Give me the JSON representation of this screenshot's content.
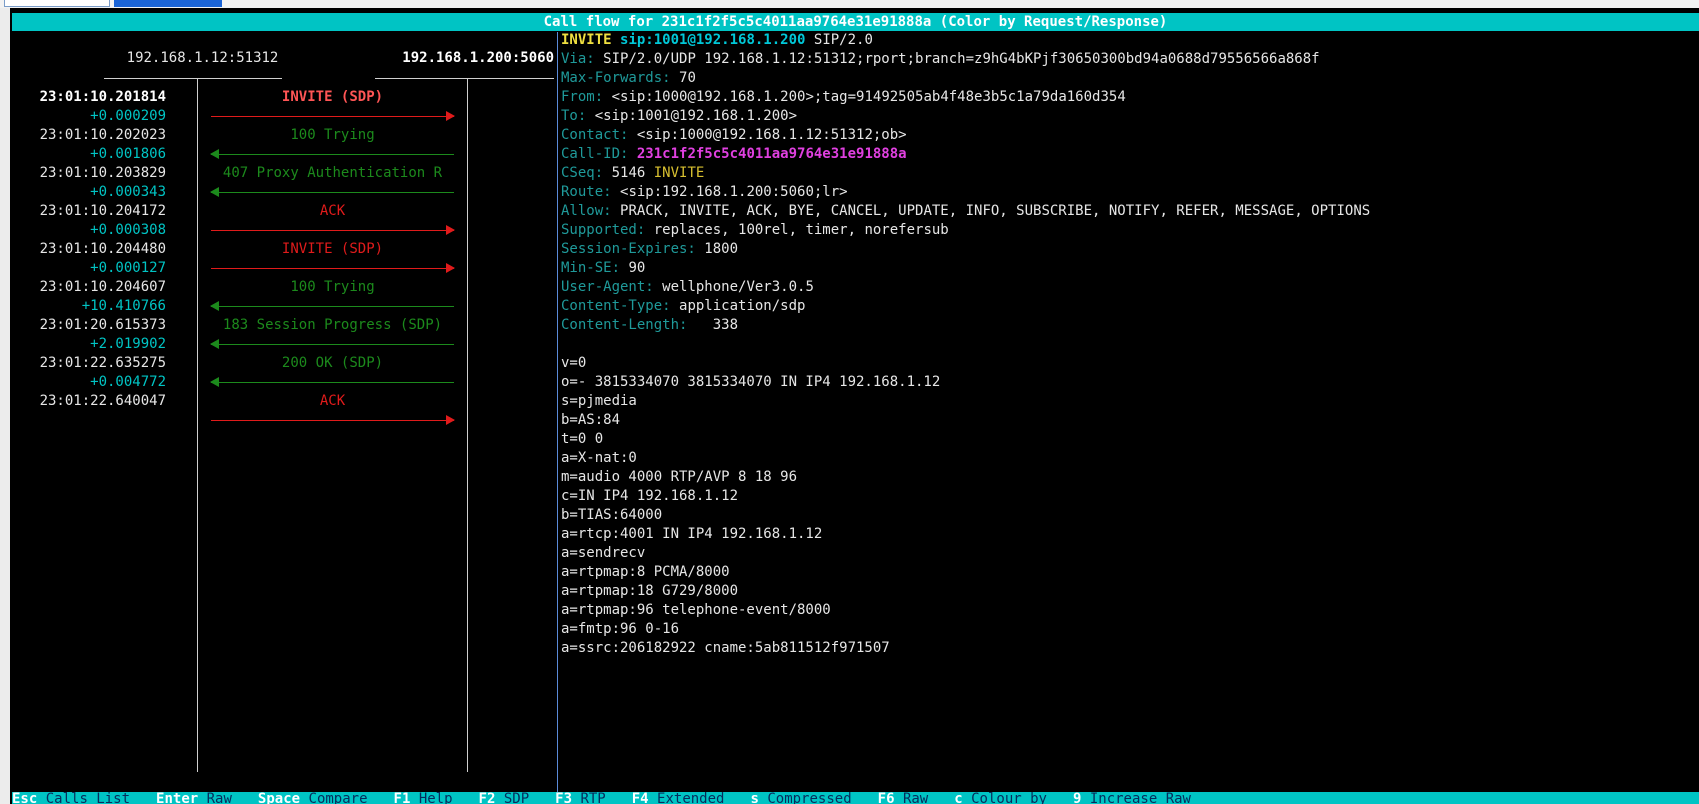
{
  "window": {
    "title": "Call flow for 231c1f2f5c5c4011aa9764e31e91888a (Color by Request/Response)"
  },
  "hosts": {
    "left": "192.168.1.12:51312",
    "right": "192.168.1.200:5060"
  },
  "flow": [
    {
      "time": "23:01:10.201814",
      "delta": "+0.000209",
      "label": "INVITE (SDP)",
      "dir": "right",
      "kind": "request",
      "selected": true
    },
    {
      "time": "23:01:10.202023",
      "delta": "+0.001806",
      "label": "100 Trying",
      "dir": "left",
      "kind": "response",
      "selected": false
    },
    {
      "time": "23:01:10.203829",
      "delta": "+0.000343",
      "label": "407 Proxy Authentication R",
      "dir": "left",
      "kind": "response",
      "selected": false
    },
    {
      "time": "23:01:10.204172",
      "delta": "+0.000308",
      "label": "ACK",
      "dir": "right",
      "kind": "request",
      "selected": false
    },
    {
      "time": "23:01:10.204480",
      "delta": "+0.000127",
      "label": "INVITE (SDP)",
      "dir": "right",
      "kind": "request",
      "selected": false
    },
    {
      "time": "23:01:10.204607",
      "delta": "+10.410766",
      "label": "100 Trying",
      "dir": "left",
      "kind": "response",
      "selected": false
    },
    {
      "time": "23:01:20.615373",
      "delta": "+2.019902",
      "label": "183 Session Progress (SDP)",
      "dir": "left",
      "kind": "response",
      "selected": false
    },
    {
      "time": "23:01:22.635275",
      "delta": "+0.004772",
      "label": "200 OK (SDP)",
      "dir": "left",
      "kind": "response",
      "selected": false
    },
    {
      "time": "23:01:22.640047",
      "delta": "",
      "label": "ACK",
      "dir": "right",
      "kind": "request",
      "selected": false
    }
  ],
  "raw": {
    "request_method": "INVITE",
    "request_uri": "sip:1001@192.168.1.200",
    "request_version": "SIP/2.0",
    "headers": [
      {
        "name": "Via:",
        "value": "SIP/2.0/UDP 192.168.1.12:51312;rport;branch=z9hG4bKPjf30650300bd94a0688d79556566a868f"
      },
      {
        "name": "Max-Forwards:",
        "value": "70"
      },
      {
        "name": "From:",
        "value": "<sip:1000@192.168.1.200>;tag=91492505ab4f48e3b5c1a79da160d354"
      },
      {
        "name": "To:",
        "value": "<sip:1001@192.168.1.200>"
      },
      {
        "name": "Contact:",
        "value": "<sip:1000@192.168.1.12:51312;ob>"
      },
      {
        "name": "Call-ID:",
        "value": "231c1f2f5c5c4011aa9764e31e91888a",
        "style": "callid"
      },
      {
        "name": "CSeq:",
        "value": "5146",
        "method": "INVITE"
      },
      {
        "name": "Route:",
        "value": "<sip:192.168.1.200:5060;lr>"
      },
      {
        "name": "Allow:",
        "value": "PRACK, INVITE, ACK, BYE, CANCEL, UPDATE, INFO, SUBSCRIBE, NOTIFY, REFER, MESSAGE, OPTIONS"
      },
      {
        "name": "Supported:",
        "value": "replaces, 100rel, timer, norefersub"
      },
      {
        "name": "Session-Expires:",
        "value": "1800"
      },
      {
        "name": "Min-SE:",
        "value": "90"
      },
      {
        "name": "User-Agent:",
        "value": "wellphone/Ver3.0.5"
      },
      {
        "name": "Content-Type:",
        "value": "application/sdp"
      },
      {
        "name": "Content-Length:",
        "value": "  338"
      }
    ],
    "body": [
      "v=0",
      "o=- 3815334070 3815334070 IN IP4 192.168.1.12",
      "s=pjmedia",
      "b=AS:84",
      "t=0 0",
      "a=X-nat:0",
      "m=audio 4000 RTP/AVP 8 18 96",
      "c=IN IP4 192.168.1.12",
      "b=TIAS:64000",
      "a=rtcp:4001 IN IP4 192.168.1.12",
      "a=sendrecv",
      "a=rtpmap:8 PCMA/8000",
      "a=rtpmap:18 G729/8000",
      "a=rtpmap:96 telephone-event/8000",
      "a=fmtp:96 0-16",
      "a=ssrc:206182922 cname:5ab811512f971507"
    ]
  },
  "footer": [
    {
      "key": "Esc",
      "label": "Calls List"
    },
    {
      "key": "Enter",
      "label": "Raw"
    },
    {
      "key": "Space",
      "label": "Compare"
    },
    {
      "key": "F1",
      "label": "Help"
    },
    {
      "key": "F2",
      "label": "SDP"
    },
    {
      "key": "F3",
      "label": "RTP"
    },
    {
      "key": "F4",
      "label": "Extended"
    },
    {
      "key": "s",
      "label": "Compressed"
    },
    {
      "key": "F6",
      "label": "Raw"
    },
    {
      "key": "c",
      "label": "Colour by"
    },
    {
      "key": "9",
      "label": "Increase Raw"
    }
  ],
  "colors": {
    "request": "#e01b1b",
    "response": "#1c8a1c",
    "accent": "#00c4c4"
  }
}
